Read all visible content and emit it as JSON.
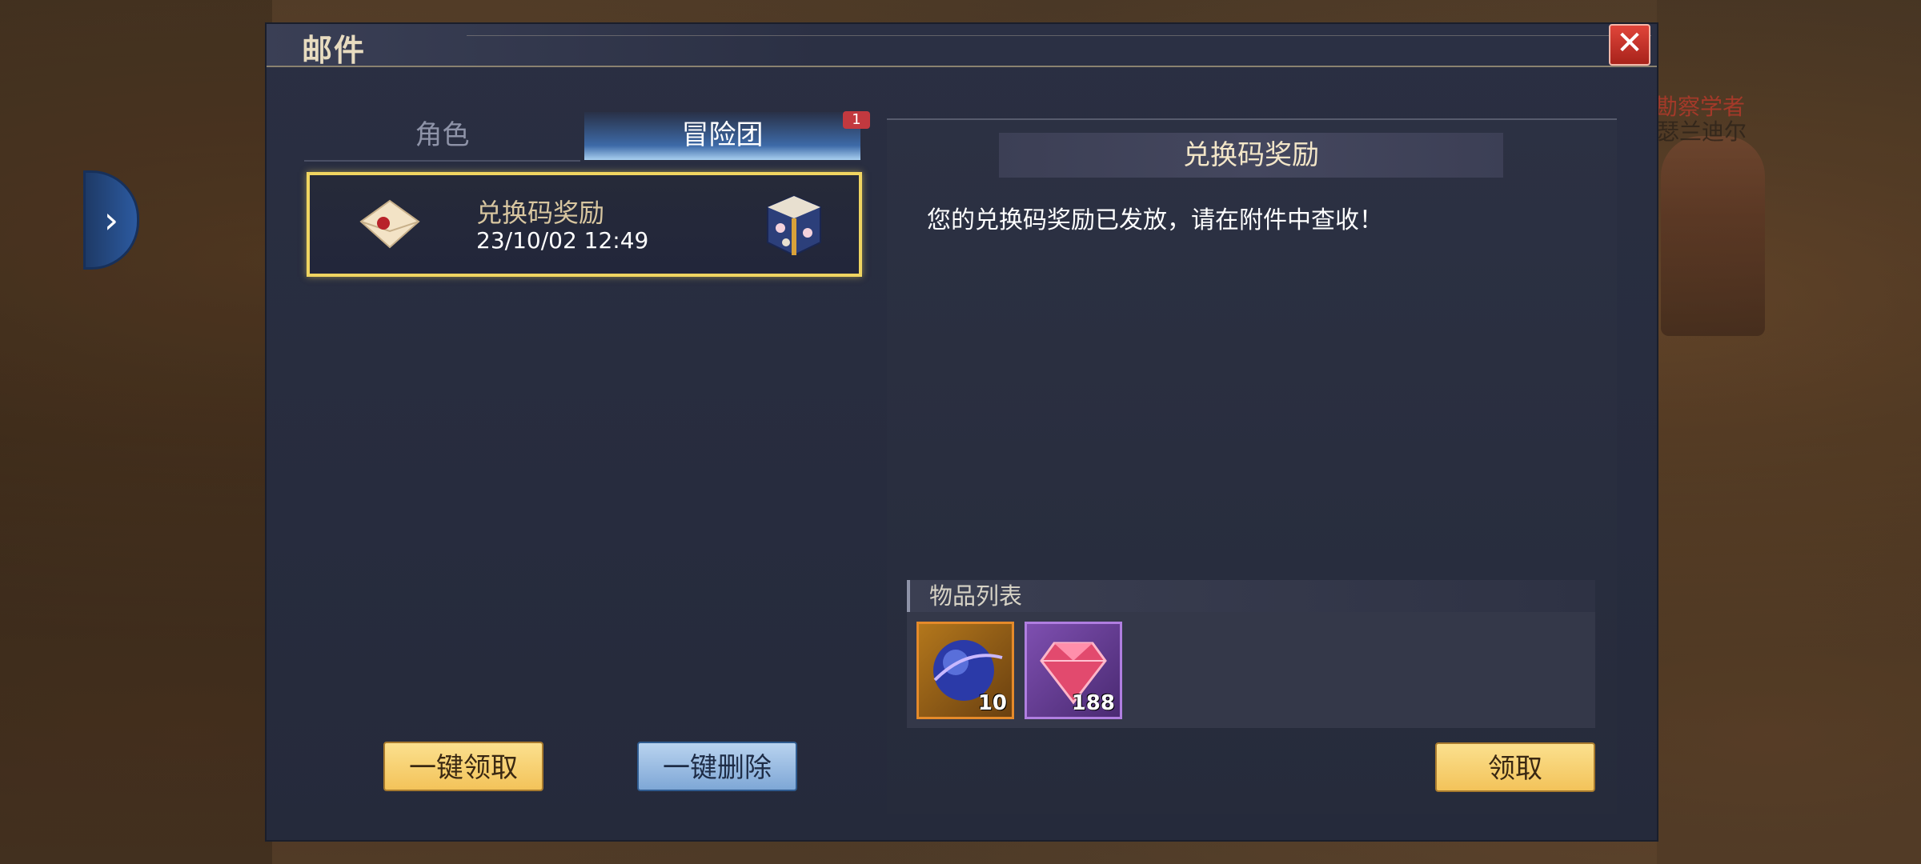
{
  "panel": {
    "title": "邮件",
    "close_icon": "close-icon"
  },
  "npc": {
    "title": "勘察学者",
    "name": "瑟兰迪尔"
  },
  "side_tab": {
    "icon": "chevron-right-icon",
    "glyph": "›"
  },
  "tabs": [
    {
      "label": "角色",
      "active": false
    },
    {
      "label": "冒险团",
      "active": true,
      "badge": "1"
    }
  ],
  "mail_list": [
    {
      "title": "兑换码奖励",
      "date": "23/10/02 12:49",
      "icon": "envelope-icon",
      "attachment_icon": "gift-box-icon"
    }
  ],
  "actions": {
    "claim_all": "一键领取",
    "delete_all": "一键删除"
  },
  "detail": {
    "title": "兑换码奖励",
    "body": "您的兑换码奖励已发放，请在附件中查收！",
    "items_header": "物品列表",
    "items": [
      {
        "icon": "blue-orb-icon",
        "qty": "10",
        "rarity_color": "#e58a2a"
      },
      {
        "icon": "pink-gem-icon",
        "qty": "188",
        "rarity_color": "#b07ee0"
      }
    ],
    "claim": "领取"
  },
  "colors": {
    "accent_gold": "#f0d561",
    "tab_active": "#3d6aa8",
    "badge": "#c2393f"
  }
}
